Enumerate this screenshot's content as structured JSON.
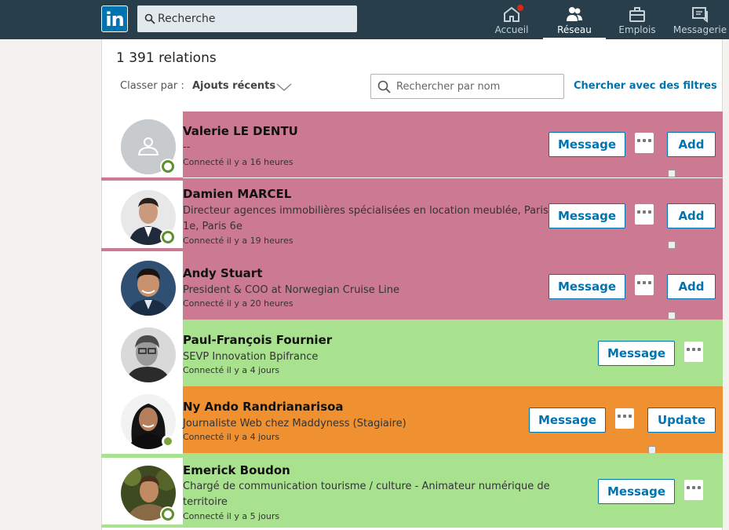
{
  "nav": {
    "logo_text": "in",
    "search_placeholder": "Recherche",
    "items": [
      {
        "label": "Accueil",
        "icon": "home-icon"
      },
      {
        "label": "Réseau",
        "icon": "network-icon"
      },
      {
        "label": "Emplois",
        "icon": "briefcase-icon"
      },
      {
        "label": "Messagerie",
        "icon": "messaging-icon"
      }
    ]
  },
  "header": {
    "count": "1 391 relations",
    "sort_label": "Classer par :",
    "sort_value": "Ajouts récents",
    "name_search_placeholder": "Rechercher par nom",
    "filters_link": "Chercher avec des filtres"
  },
  "colors": {
    "pink": "#cc7a92",
    "green": "#a8e28f",
    "orange": "#ef9130",
    "brand_blue": "#0073b1"
  },
  "connections": [
    {
      "name": "Valerie LE DENTU",
      "title": "--",
      "time": "Connecté il y a 16 heures",
      "message_label": "Message",
      "action_label": "Add",
      "avatar": "placeholder-avatar-icon"
    },
    {
      "name": "Damien MARCEL",
      "title": "Directeur agences immobilières spécialisées en location meublée, Paris 1e, Paris 6e",
      "time": "Connecté il y a 19 heures",
      "message_label": "Message",
      "action_label": "Add",
      "avatar": "person-photo"
    },
    {
      "name": "Andy Stuart",
      "title": "President & COO at Norwegian Cruise Line",
      "time": "Connecté il y a 20 heures",
      "message_label": "Message",
      "action_label": "Add",
      "avatar": "person-photo"
    },
    {
      "name": "Paul-François Fournier",
      "title": "SEVP Innovation Bpifrance",
      "time": "Connecté il y a 4 jours",
      "message_label": "Message",
      "avatar": "person-photo"
    },
    {
      "name": "Ny Ando Randrianarisoa",
      "title": "Journaliste Web chez Maddyness (Stagiaire)",
      "time": "Connecté il y a 4 jours",
      "message_label": "Message",
      "action_label": "Update",
      "avatar": "person-photo"
    },
    {
      "name": "Emerick Boudon",
      "title": "Chargé de communication tourisme / culture - Animateur numérique de territoire",
      "time": "Connecté il y a 5 jours",
      "message_label": "Message",
      "avatar": "person-photo"
    }
  ]
}
